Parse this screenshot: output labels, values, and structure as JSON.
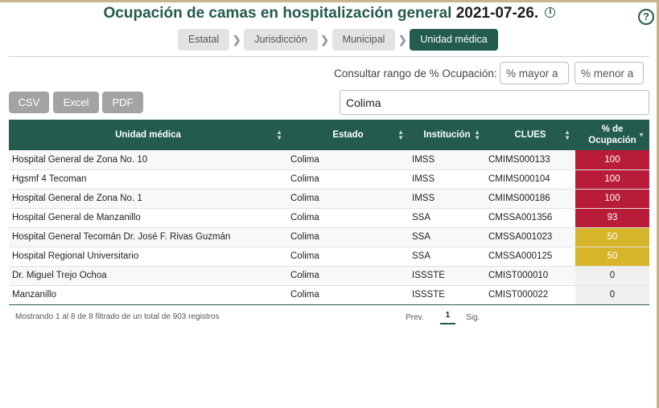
{
  "header": {
    "title": "Ocupación de camas en hospitalización general",
    "date": "2021-07-26."
  },
  "breadcrumb": [
    {
      "label": "Estatal",
      "active": false
    },
    {
      "label": "Jurisdicción",
      "active": false
    },
    {
      "label": "Municipal",
      "active": false
    },
    {
      "label": "Unidad médica",
      "active": true
    }
  ],
  "filters": {
    "range_label": "Consultar rango de % Ocupación:",
    "min_placeholder": "% mayor a",
    "max_placeholder": "% menor a",
    "search_value": "Colima"
  },
  "export": {
    "csv": "CSV",
    "excel": "Excel",
    "pdf": "PDF"
  },
  "table": {
    "columns": [
      "Unidad médica",
      "Estado",
      "Institución",
      "CLUES",
      "% de Ocupación"
    ],
    "rows": [
      {
        "unidad": "Hospital General de Zona No. 10",
        "estado": "Colima",
        "institucion": "IMSS",
        "clues": "CMIMS000133",
        "ocupacion": "100",
        "level": "red"
      },
      {
        "unidad": "Hgsmf 4 Tecoman",
        "estado": "Colima",
        "institucion": "IMSS",
        "clues": "CMIMS000104",
        "ocupacion": "100",
        "level": "red"
      },
      {
        "unidad": "Hospital General de Zona No. 1",
        "estado": "Colima",
        "institucion": "IMSS",
        "clues": "CMIMS000186",
        "ocupacion": "100",
        "level": "red"
      },
      {
        "unidad": "Hospital General de Manzanillo",
        "estado": "Colima",
        "institucion": "SSA",
        "clues": "CMSSA001356",
        "ocupacion": "93",
        "level": "red"
      },
      {
        "unidad": "Hospital General Tecomán Dr. José F. Rivas Guzmán",
        "estado": "Colima",
        "institucion": "SSA",
        "clues": "CMSSA001023",
        "ocupacion": "50",
        "level": "yellow"
      },
      {
        "unidad": "Hospital Regional Universitario",
        "estado": "Colima",
        "institucion": "SSA",
        "clues": "CMSSA000125",
        "ocupacion": "50",
        "level": "yellow"
      },
      {
        "unidad": "Dr. Miguel Trejo Ochoa",
        "estado": "Colima",
        "institucion": "ISSSTE",
        "clues": "CMIST000010",
        "ocupacion": "0",
        "level": "gray"
      },
      {
        "unidad": "Manzanillo",
        "estado": "Colima",
        "institucion": "ISSSTE",
        "clues": "CMIST000022",
        "ocupacion": "0",
        "level": "gray"
      }
    ]
  },
  "footer": {
    "info": "Mostrando 1 al 8 de 8 filtrado de un total de 903 registros",
    "prev": "Prev.",
    "page": "1",
    "next": "Sig."
  },
  "colors": {
    "brand": "#235b4e",
    "high": "#b81c38",
    "medium": "#d6b52a",
    "low": "#f0f0f0"
  },
  "icons": [
    "info-icon",
    "help-icon",
    "chevron-right-icon",
    "sort-icon"
  ]
}
